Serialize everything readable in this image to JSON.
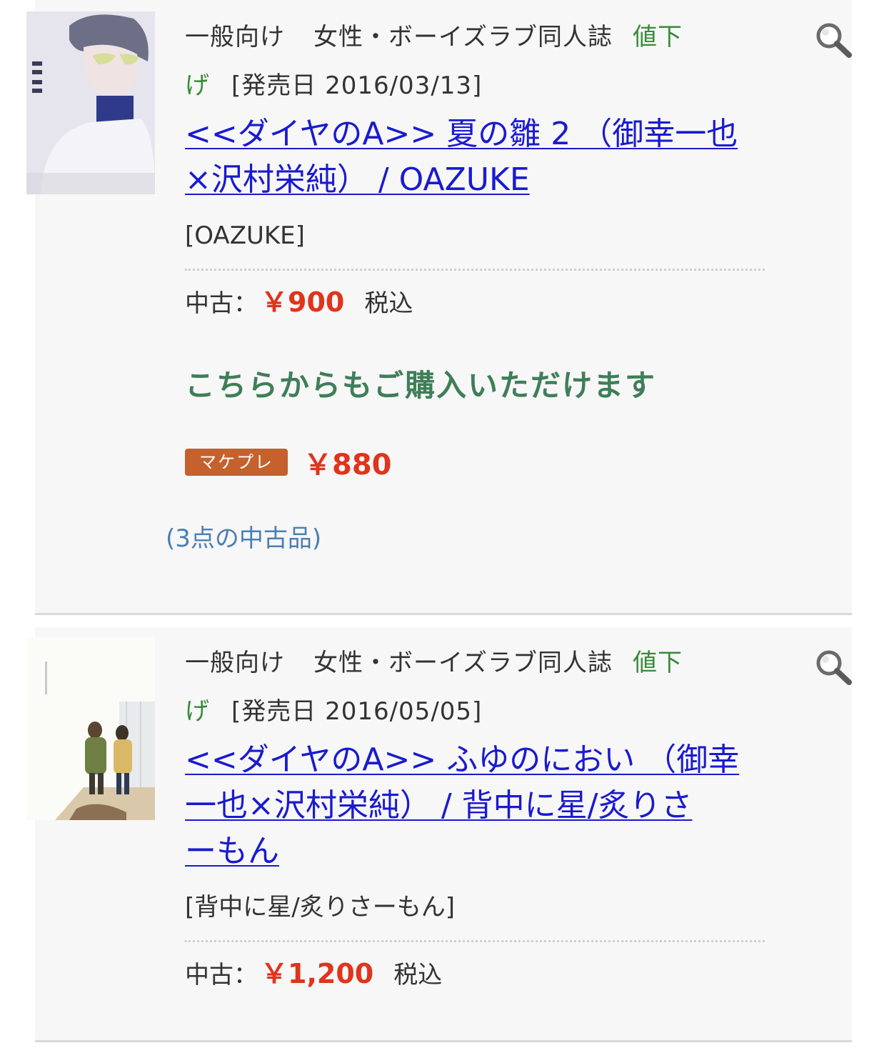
{
  "items": [
    {
      "category": "一般向け",
      "genre": "女性・ボーイズラブ同人誌",
      "price_down_label_1": "値下",
      "price_down_label_2": "げ",
      "release": "[発売日 2016/03/13]",
      "title_line_1": "<<ダイヤのA>> 夏の雛 2 （御幸一也",
      "title_line_2": "×沢村栄純）  / OAZUKE",
      "circle": "[OAZUKE]",
      "condition": "中古：",
      "price": "￥900",
      "tax": "税込",
      "also_buy": "こちらからもご購入いただけます",
      "marketplace_badge": "マケプレ",
      "marketplace_price": "￥880",
      "used_count": "(3点の中古品)",
      "cover_icon": "book-cover-image"
    },
    {
      "category": "一般向け",
      "genre": "女性・ボーイズラブ同人誌",
      "price_down_label_1": "値下",
      "price_down_label_2": "げ",
      "release": "[発売日 2016/05/05]",
      "title_line_1": "<<ダイヤのA>> ふゆのにおい （御幸",
      "title_line_2": "一也×沢村栄純）  / 背中に星/炙りさ",
      "title_line_3": "ーもん",
      "circle": "[背中に星/炙りさーもん]",
      "condition": "中古：",
      "price": "￥1,200",
      "tax": "税込",
      "cover_icon": "book-cover-image"
    }
  ],
  "icons": {
    "search": "search-icon"
  },
  "colors": {
    "price": "#e0341c",
    "link": "#1a1ad0",
    "price_down": "#3a8a3a",
    "also_buy": "#3f7e58",
    "marketplace_badge": "#c4612d",
    "used_count": "#4a7fb5"
  }
}
